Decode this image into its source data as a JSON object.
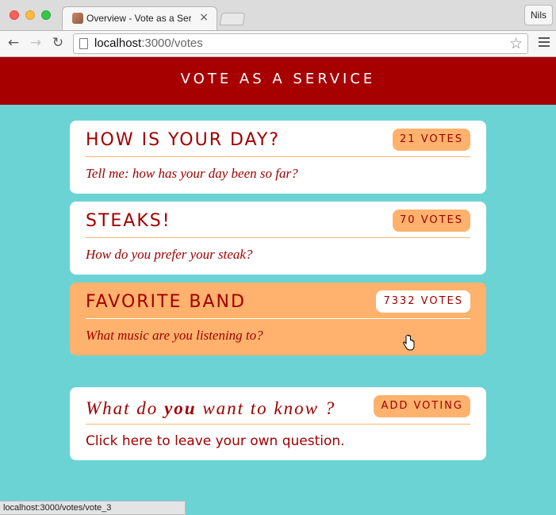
{
  "browser": {
    "tab_title": "Overview - Vote as a Servic",
    "tab_close": "×",
    "profile_name": "Nils",
    "url_host": "localhost",
    "url_rest": ":3000/votes",
    "status_url": "localhost:3000/votes/vote_3",
    "icons": {
      "back": "←",
      "forward": "→",
      "reload": "↻",
      "bookmark": "☆"
    }
  },
  "app": {
    "title": "VOTE AS A SERVICE",
    "accent": "#a60000",
    "background": "#6bd3d4",
    "highlight": "#feb26d"
  },
  "votings": [
    {
      "title": "HOW IS YOUR DAY?",
      "votes": "21 VOTES",
      "description": "Tell me: how has your day been so far?"
    },
    {
      "title": "STEAKS!",
      "votes": "70 VOTES",
      "description": "How do you prefer your steak?"
    },
    {
      "title": "FAVORITE BAND",
      "votes": "7332 VOTES",
      "description": "What music are you listening to?"
    }
  ],
  "ask": {
    "title_before": "What do",
    "title_bold": "you",
    "title_after": "want to know ?",
    "button": "ADD VOTING",
    "link": "Click here to leave your own question."
  }
}
